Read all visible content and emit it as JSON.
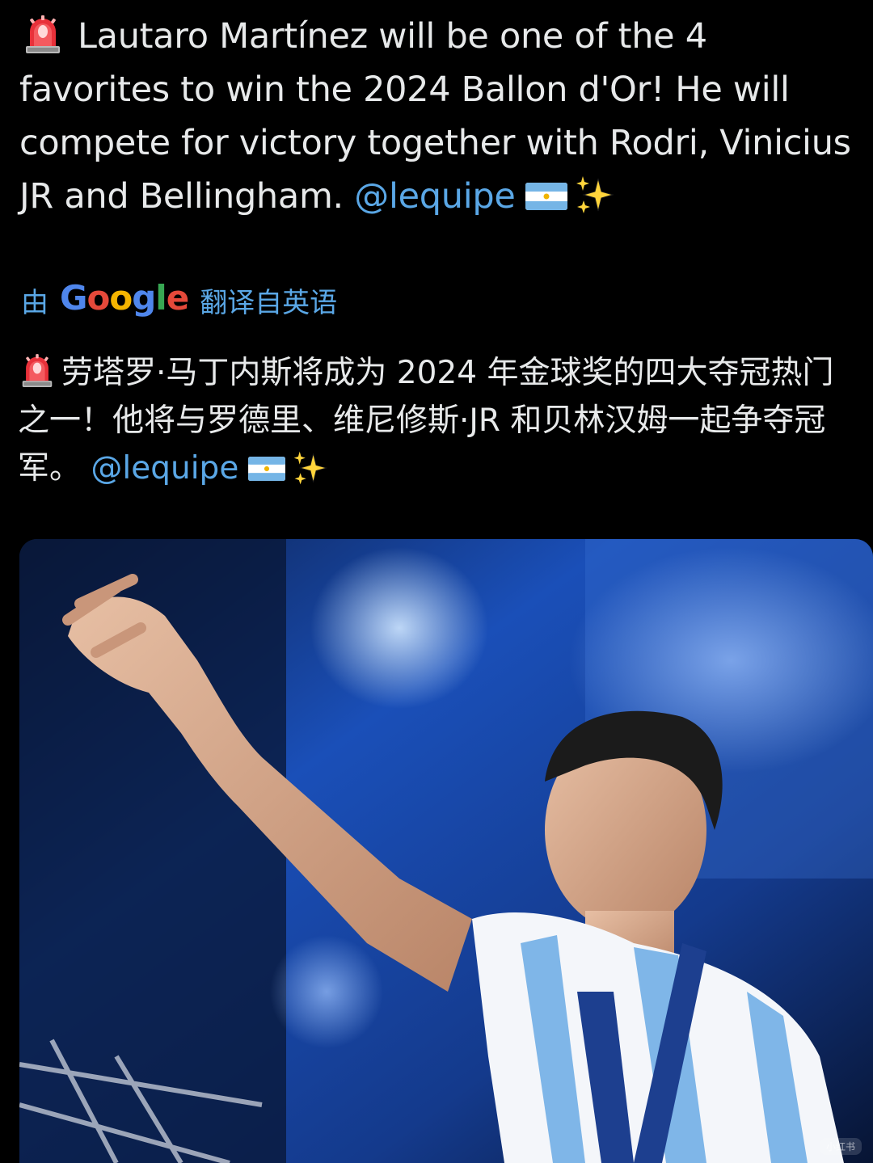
{
  "tweet": {
    "text_main": "Lautaro Martínez will be one of the 4 favorites to win the 2024 Ballon d'Or! He will compete for victory together with Rodri, Vinicius JR and Bellingham.",
    "mention": "@lequipe",
    "icons": [
      "police-siren-icon",
      "argentina-flag-icon",
      "sparkles-icon"
    ]
  },
  "translation": {
    "prefix": "由",
    "provider": "Google",
    "suffix": "翻译自英语",
    "text_main": "劳塔罗·马丁内斯将成为 2024 年金球奖的四大夺冠热门之一！他将与罗德里、维尼修斯·JR 和贝林汉姆一起争夺冠军。",
    "mention": "@lequipe"
  },
  "media": {
    "type": "photo",
    "watermark": "小红书"
  },
  "colors": {
    "background": "#000000",
    "text": "#e7e9ea",
    "link": "#5aa7e6",
    "google_blue": "#4f86ec",
    "google_red": "#e5493a",
    "google_yellow": "#f5b400",
    "google_green": "#38a753"
  }
}
